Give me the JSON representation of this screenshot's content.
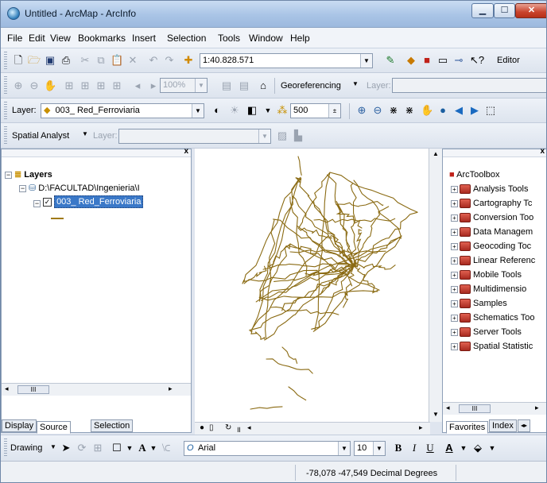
{
  "window": {
    "title": "Untitled - ArcMap - ArcInfo"
  },
  "menu": [
    "File",
    "Edit",
    "View",
    "Bookmarks",
    "Insert",
    "Selection",
    "Tools",
    "Window",
    "Help"
  ],
  "standard_toolbar": {
    "scale": "1:40.828.571",
    "editor_label": "Editor"
  },
  "georef_toolbar": {
    "zoom": "100%",
    "georef_label": "Georeferencing",
    "layer_label": "Layer:"
  },
  "tools_toolbar": {
    "layer_label": "Layer:",
    "layer_value": "003_ Red_Ferroviaria",
    "spin_value": "500"
  },
  "spatial_toolbar": {
    "label": "Spatial Analyst",
    "layer_label": "Layer:"
  },
  "toc": {
    "root": "Layers",
    "frame": "D:\\FACULTAD\\Ingenieria\\I",
    "layer": "003_ Red_Ferroviaria",
    "tabs": [
      "Display",
      "Source",
      "Selection"
    ]
  },
  "toolbox": {
    "root": "ArcToolbox",
    "items": [
      "Analysis Tools",
      "Cartography Tc",
      "Conversion Too",
      "Data Managem",
      "Geocoding Toc",
      "Linear Referenc",
      "Mobile Tools",
      "Multidimensio",
      "Samples",
      "Schematics Too",
      "Server Tools",
      "Spatial Statistic"
    ],
    "tabs": [
      "Favorites",
      "Index"
    ]
  },
  "drawing": {
    "label": "Drawing",
    "font": "Arial",
    "size": "10"
  },
  "status": {
    "coords": "-78,078  -47,549 Decimal Degrees"
  },
  "colors": {
    "rail_line": "#8a6a12",
    "selection": "#3a78c8"
  }
}
